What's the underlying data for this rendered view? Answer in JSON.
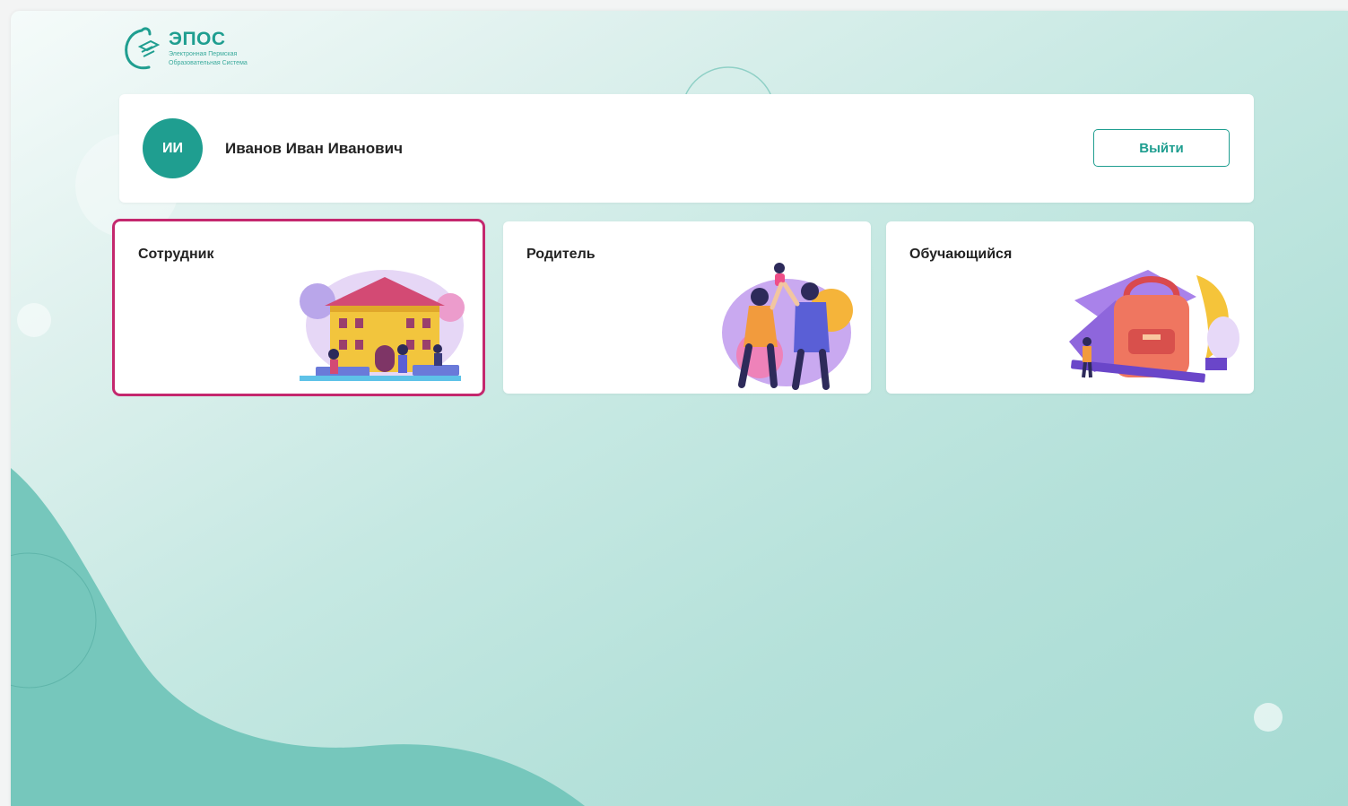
{
  "logo": {
    "name": "ЭПОС",
    "subtitle_line1": "Электронная Пермская",
    "subtitle_line2": "Образовательная Система"
  },
  "user": {
    "initials": "ИИ",
    "full_name": "Иванов Иван Иванович",
    "logout_label": "Выйти"
  },
  "roles": [
    {
      "label": "Сотрудник",
      "selected": true,
      "icon": "school-building-icon"
    },
    {
      "label": "Родитель",
      "selected": false,
      "icon": "family-icon"
    },
    {
      "label": "Обучающийся",
      "selected": false,
      "icon": "backpack-icon"
    }
  ],
  "colors": {
    "brand": "#1f9e90",
    "selection": "#c4286e",
    "card": "#ffffff"
  }
}
